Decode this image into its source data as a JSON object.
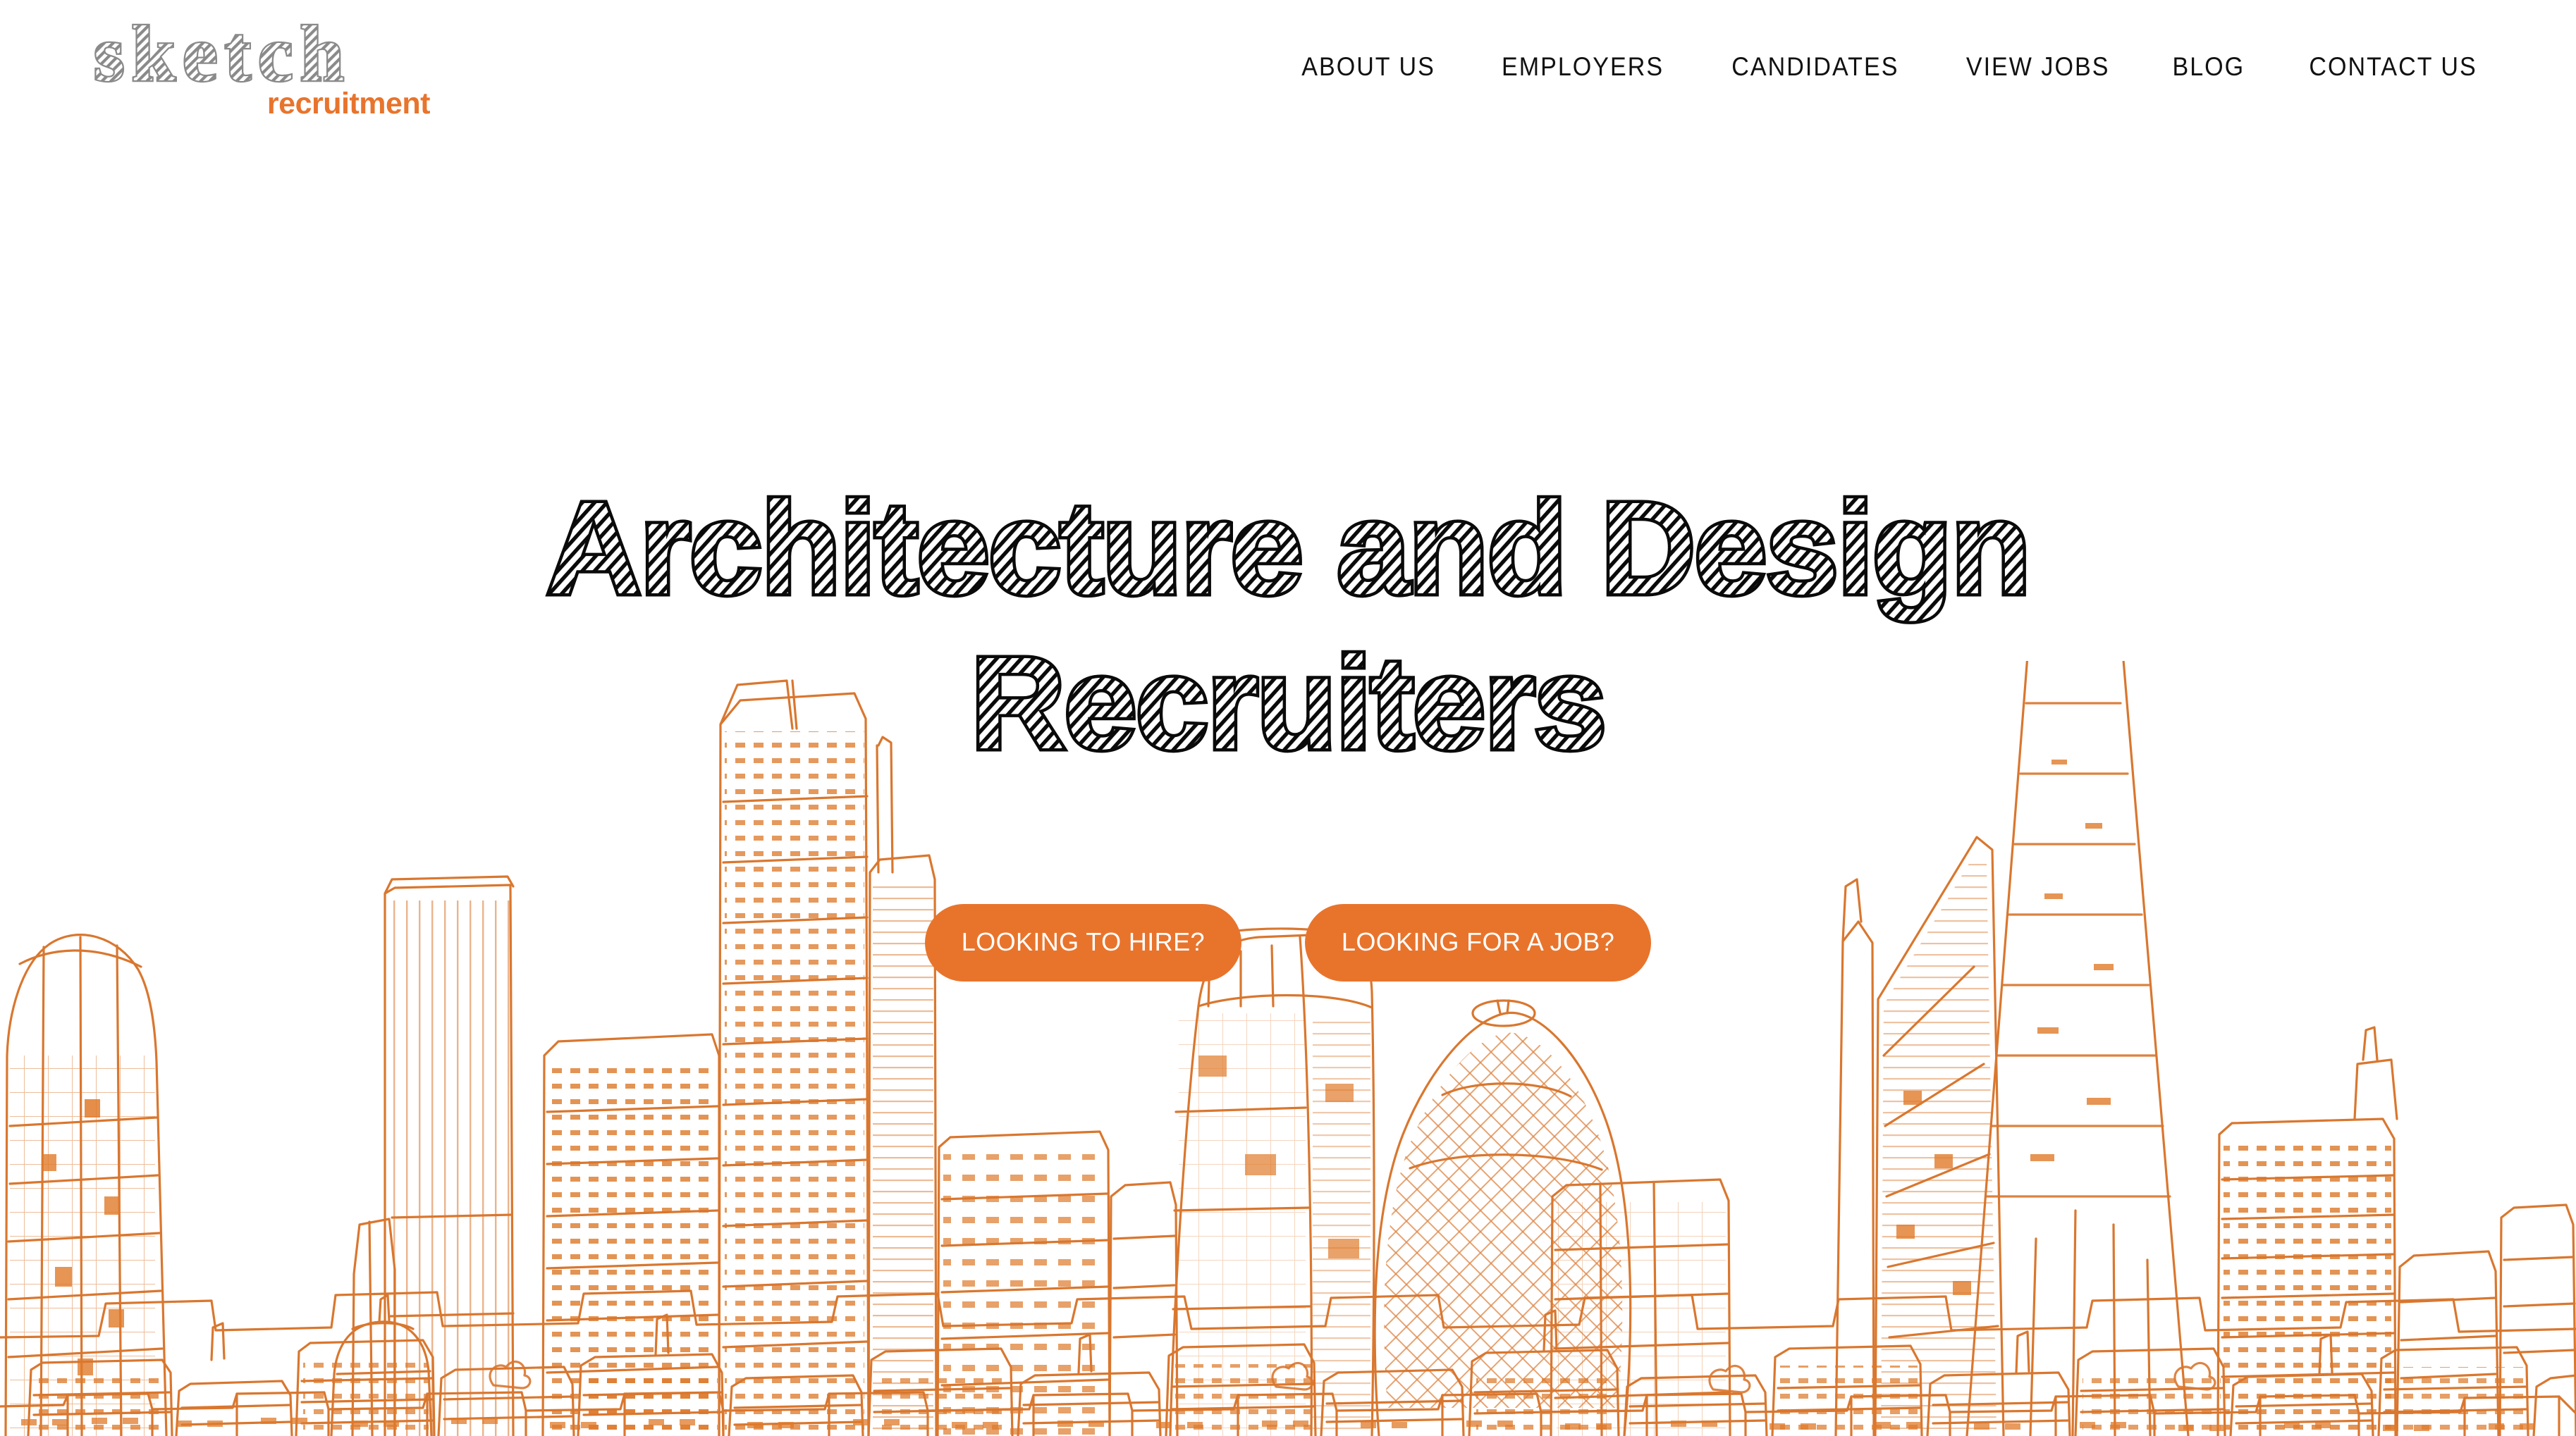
{
  "brand": {
    "logo_word": "sketch",
    "logo_subword": "recruitment",
    "logo_grey": "#8a8a8a",
    "accent_orange": "#E8742C",
    "ink_black": "#111111",
    "background": "#ffffff"
  },
  "header": {
    "nav": [
      {
        "label": "ABOUT US",
        "name": "nav-about-us"
      },
      {
        "label": "EMPLOYERS",
        "name": "nav-employers"
      },
      {
        "label": "CANDIDATES",
        "name": "nav-candidates"
      },
      {
        "label": "VIEW JOBS",
        "name": "nav-view-jobs"
      },
      {
        "label": "BLOG",
        "name": "nav-blog"
      },
      {
        "label": "CONTACT US",
        "name": "nav-contact-us"
      }
    ]
  },
  "hero": {
    "heading_line_1": "Architecture and Design",
    "heading_line_2": "Recruiters",
    "heading_full": "Architecture and Design Recruiters",
    "cta_primary": "LOOKING TO HIRE?",
    "cta_secondary": "LOOKING FOR A JOB?",
    "illustration": "london-skyline-line-drawing"
  }
}
